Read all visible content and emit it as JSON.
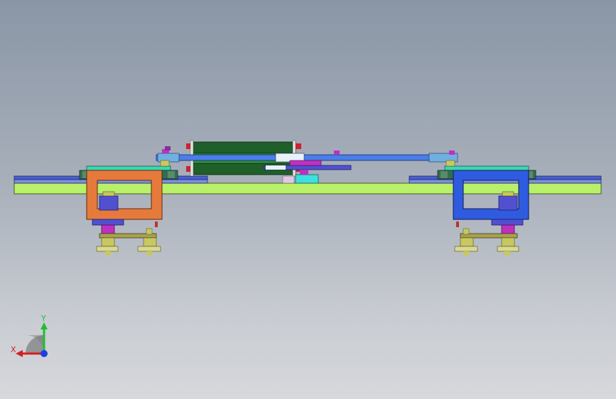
{
  "viewport": {
    "background_top": "#8a96a6",
    "background_bottom": "#d6d8dc"
  },
  "triad": {
    "x_label": "X",
    "y_label": "Y",
    "x_color": "#d42020",
    "y_color": "#1fbf2f",
    "z_color": "#1f3fe0"
  },
  "colors": {
    "base_plate": "#b9f06a",
    "rail": "#4a5fc8",
    "left_frame": "#e67a3c",
    "right_frame": "#2f5be0",
    "cylinder_body": "#1f5f2a",
    "rod": "#4a7ee8",
    "top_plate": "#3cd6b0",
    "motor": "#5050d0",
    "bracket": "#a8a050",
    "magenta_part": "#c030c0"
  }
}
